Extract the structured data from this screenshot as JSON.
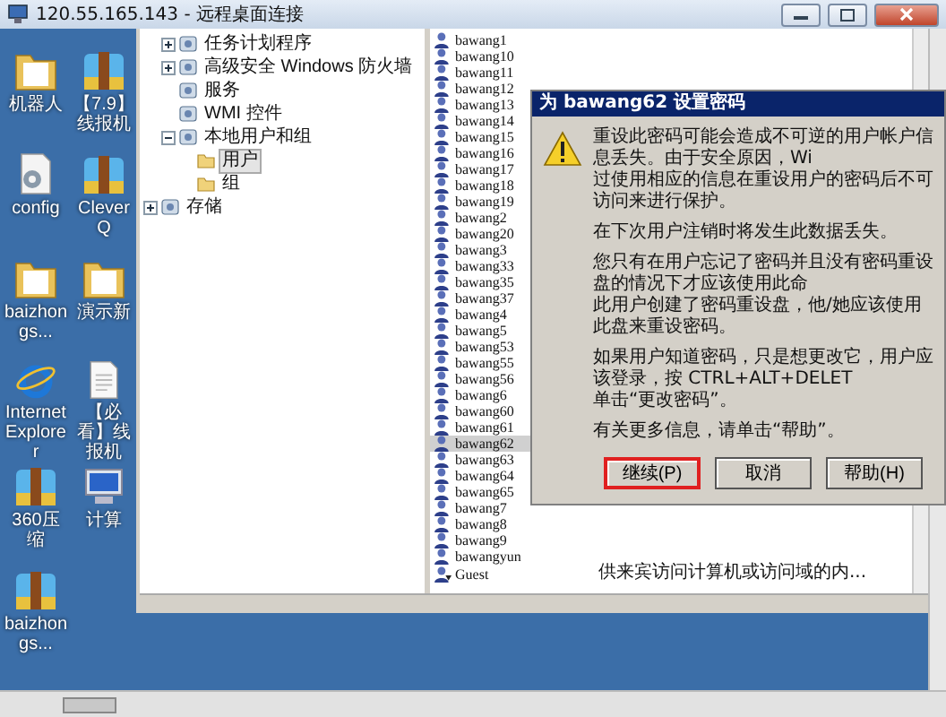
{
  "title_bar": {
    "title": "120.55.165.143 - 远程桌面连接"
  },
  "desktop_icons": [
    {
      "label": "机器人",
      "kind": "folder"
    },
    {
      "label": "【7.9】线报机",
      "kind": "archive"
    },
    {
      "label": "config",
      "kind": "settings-file"
    },
    {
      "label": "CleverQ",
      "kind": "archive"
    },
    {
      "label": "baizhongs...",
      "kind": "folder"
    },
    {
      "label": "演示新",
      "kind": "folder"
    },
    {
      "label": "Internet Explorer",
      "kind": "browser"
    },
    {
      "label": "【必看】线报机",
      "kind": "document"
    },
    {
      "label": "360压缩",
      "kind": "archive"
    },
    {
      "label": "计算",
      "kind": "computer"
    },
    {
      "label": "baizhongs...",
      "kind": "archive"
    }
  ],
  "tree": [
    {
      "children": [
        {
          "label": "任务计划程序",
          "expanded": false,
          "selected": false
        },
        {
          "label": "高级安全 Windows 防火墙",
          "expanded": false,
          "selected": false
        },
        {
          "label": "服务",
          "selected": false
        },
        {
          "label": "WMI 控件",
          "selected": false
        },
        {
          "label": "本地用户和组",
          "expanded": true,
          "selected": false,
          "children": [
            {
              "label": "用户",
              "selected": true
            },
            {
              "label": "组",
              "selected": false
            }
          ]
        }
      ]
    },
    {
      "label": "存储",
      "expanded": false,
      "selected": false
    }
  ],
  "users": [
    {
      "name": "bawang1",
      "selected": false,
      "disabled": false
    },
    {
      "name": "bawang10",
      "selected": false,
      "disabled": false
    },
    {
      "name": "bawang11",
      "selected": false,
      "disabled": false
    },
    {
      "name": "bawang12",
      "selected": false,
      "disabled": false
    },
    {
      "name": "bawang13",
      "selected": false,
      "disabled": false
    },
    {
      "name": "bawang14",
      "selected": false,
      "disabled": false
    },
    {
      "name": "bawang15",
      "selected": false,
      "disabled": false
    },
    {
      "name": "bawang16",
      "selected": false,
      "disabled": false
    },
    {
      "name": "bawang17",
      "selected": false,
      "disabled": false
    },
    {
      "name": "bawang18",
      "selected": false,
      "disabled": false
    },
    {
      "name": "bawang19",
      "selected": false,
      "disabled": false
    },
    {
      "name": "bawang2",
      "selected": false,
      "disabled": false
    },
    {
      "name": "bawang20",
      "selected": false,
      "disabled": false
    },
    {
      "name": "bawang3",
      "selected": false,
      "disabled": false
    },
    {
      "name": "bawang33",
      "selected": false,
      "disabled": false
    },
    {
      "name": "bawang35",
      "selected": false,
      "disabled": false
    },
    {
      "name": "bawang37",
      "selected": false,
      "disabled": false
    },
    {
      "name": "bawang4",
      "selected": false,
      "disabled": false
    },
    {
      "name": "bawang5",
      "selected": false,
      "disabled": false
    },
    {
      "name": "bawang53",
      "selected": false,
      "disabled": false
    },
    {
      "name": "bawang55",
      "selected": false,
      "disabled": false
    },
    {
      "name": "bawang56",
      "selected": false,
      "disabled": false
    },
    {
      "name": "bawang6",
      "selected": false,
      "disabled": false
    },
    {
      "name": "bawang60",
      "selected": false,
      "disabled": false
    },
    {
      "name": "bawang61",
      "selected": false,
      "disabled": false
    },
    {
      "name": "bawang62",
      "selected": true,
      "disabled": false
    },
    {
      "name": "bawang63",
      "selected": false,
      "disabled": false
    },
    {
      "name": "bawang64",
      "selected": false,
      "disabled": false
    },
    {
      "name": "bawang65",
      "selected": false,
      "disabled": false
    },
    {
      "name": "bawang7",
      "selected": false,
      "disabled": false
    },
    {
      "name": "bawang8",
      "selected": false,
      "disabled": false
    },
    {
      "name": "bawang9",
      "selected": false,
      "disabled": false
    },
    {
      "name": "bawangyun",
      "selected": false,
      "disabled": false
    },
    {
      "name": "Guest",
      "selected": false,
      "disabled": true,
      "description": "供来宾访问计算机或访问域的内..."
    }
  ],
  "dialog": {
    "title": "为 bawang62 设置密码",
    "paragraphs": [
      [
        "重设此密码可能会造成不可逆的用户帐户信息丢失。由于安全原因，Wi",
        "过使用相应的信息在重设用户的密码后不可访问来进行保护。"
      ],
      [
        "在下次用户注销时将发生此数据丢失。"
      ],
      [
        "您只有在用户忘记了密码并且没有密码重设盘的情况下才应该使用此命",
        "此用户创建了密码重设盘，他/她应该使用此盘来重设密码。"
      ],
      [
        "如果用户知道密码，只是想更改它，用户应该登录，按 CTRL+ALT+DELET",
        "单击“更改密码”。"
      ],
      [
        "有关更多信息，请单击“帮助”。"
      ]
    ],
    "buttons": [
      {
        "label": "继续(P)",
        "highlighted": true
      },
      {
        "label": "取消",
        "highlighted": false
      },
      {
        "label": "帮助(H)",
        "highlighted": false
      }
    ]
  }
}
